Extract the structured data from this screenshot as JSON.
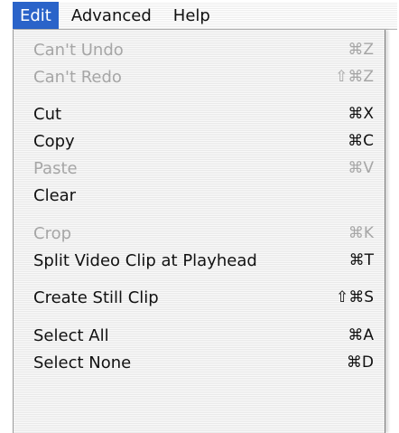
{
  "menubar": {
    "titles": [
      "Edit",
      "Advanced",
      "Help"
    ]
  },
  "menu": {
    "items": [
      {
        "label": "Can't Undo",
        "shortcut": "⌘Z",
        "enabled": false
      },
      {
        "label": "Can't Redo",
        "shortcut": "⇧⌘Z",
        "enabled": false
      },
      {
        "label": "Cut",
        "shortcut": "⌘X",
        "enabled": true
      },
      {
        "label": "Copy",
        "shortcut": "⌘C",
        "enabled": true
      },
      {
        "label": "Paste",
        "shortcut": "⌘V",
        "enabled": false
      },
      {
        "label": "Clear",
        "shortcut": "",
        "enabled": true
      },
      {
        "label": "Crop",
        "shortcut": "⌘K",
        "enabled": false
      },
      {
        "label": "Split Video Clip at Playhead",
        "shortcut": "⌘T",
        "enabled": true
      },
      {
        "label": "Create Still Clip",
        "shortcut": "⇧⌘S",
        "enabled": true
      },
      {
        "label": "Select All",
        "shortcut": "⌘A",
        "enabled": true
      },
      {
        "label": "Select None",
        "shortcut": "⌘D",
        "enabled": true
      }
    ]
  }
}
